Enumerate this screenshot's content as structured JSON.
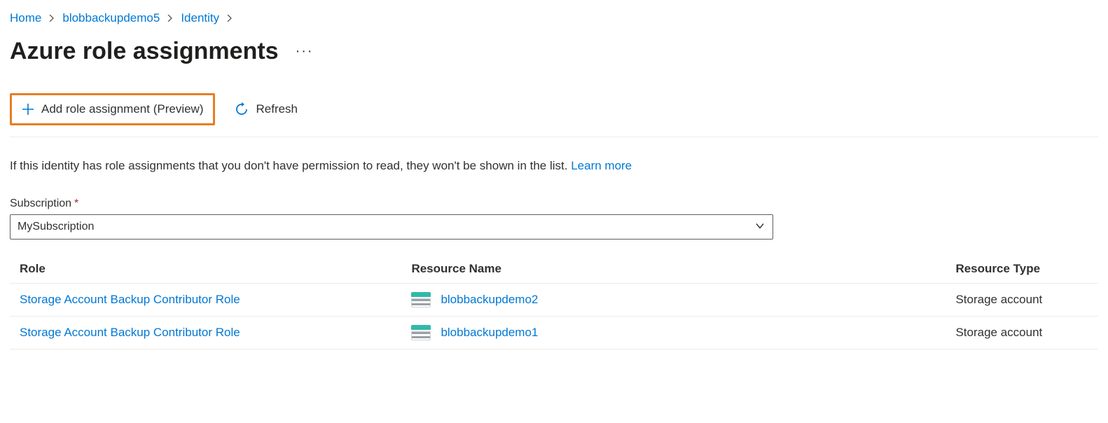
{
  "breadcrumb": {
    "items": [
      {
        "label": "Home"
      },
      {
        "label": "blobbackupdemo5"
      },
      {
        "label": "Identity"
      }
    ]
  },
  "page": {
    "title": "Azure role assignments"
  },
  "toolbar": {
    "add_role_label": "Add role assignment (Preview)",
    "refresh_label": "Refresh"
  },
  "info": {
    "text": "If this identity has role assignments that you don't have permission to read, they won't be shown in the list. ",
    "learn_more": "Learn more"
  },
  "subscription": {
    "label": "Subscription",
    "value": "MySubscription"
  },
  "table": {
    "headers": {
      "role": "Role",
      "resource_name": "Resource Name",
      "resource_type": "Resource Type"
    },
    "rows": [
      {
        "role": "Storage Account Backup Contributor Role",
        "resource_name": "blobbackupdemo2",
        "resource_type": "Storage account"
      },
      {
        "role": "Storage Account Backup Contributor Role",
        "resource_name": "blobbackupdemo1",
        "resource_type": "Storage account"
      }
    ]
  }
}
